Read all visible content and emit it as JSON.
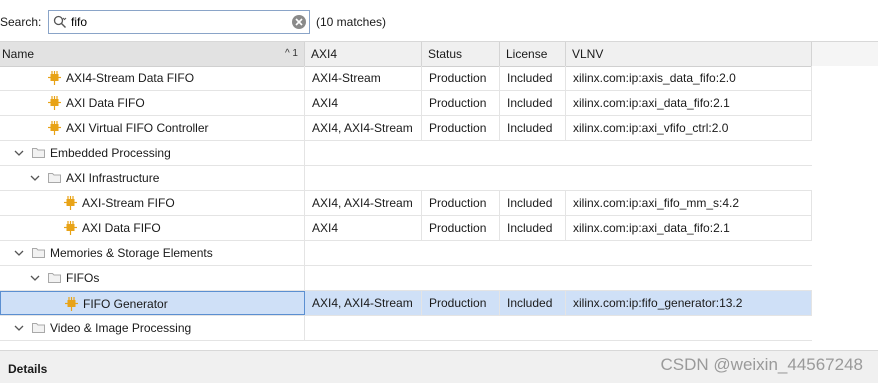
{
  "search": {
    "label": "Search:",
    "value": "fifo",
    "matches": "(10 matches)"
  },
  "columns": {
    "name": "Name",
    "sort": "^ 1",
    "axi4": "AXI4",
    "status": "Status",
    "license": "License",
    "vlnv": "VLNV"
  },
  "rows": [
    {
      "type": "ip",
      "level": 2,
      "name": "AXI4-Stream Data FIFO",
      "axi4": "AXI4-Stream",
      "status": "Production",
      "license": "Included",
      "vlnv": "xilinx.com:ip:axis_data_fifo:2.0"
    },
    {
      "type": "ip",
      "level": 2,
      "name": "AXI Data FIFO",
      "axi4": "AXI4",
      "status": "Production",
      "license": "Included",
      "vlnv": "xilinx.com:ip:axi_data_fifo:2.1"
    },
    {
      "type": "ip",
      "level": 2,
      "name": "AXI Virtual FIFO Controller",
      "axi4": "AXI4, AXI4-Stream",
      "status": "Production",
      "license": "Included",
      "vlnv": "xilinx.com:ip:axi_vfifo_ctrl:2.0"
    },
    {
      "type": "folder",
      "level": 0,
      "name": "Embedded Processing"
    },
    {
      "type": "folder",
      "level": 1,
      "name": "AXI Infrastructure"
    },
    {
      "type": "ip",
      "level": 3,
      "name": "AXI-Stream FIFO",
      "axi4": "AXI4, AXI4-Stream",
      "status": "Production",
      "license": "Included",
      "vlnv": "xilinx.com:ip:axi_fifo_mm_s:4.2"
    },
    {
      "type": "ip",
      "level": 3,
      "name": "AXI Data FIFO",
      "axi4": "AXI4",
      "status": "Production",
      "license": "Included",
      "vlnv": "xilinx.com:ip:axi_data_fifo:2.1"
    },
    {
      "type": "folder",
      "level": 0,
      "name": "Memories & Storage Elements"
    },
    {
      "type": "folder",
      "level": 1,
      "name": "FIFOs"
    },
    {
      "type": "ip",
      "level": 3,
      "name": "FIFO Generator",
      "axi4": "AXI4, AXI4-Stream",
      "status": "Production",
      "license": "Included",
      "vlnv": "xilinx.com:ip:fifo_generator:13.2",
      "selected": true
    },
    {
      "type": "folder",
      "level": 0,
      "name": "Video & Image Processing"
    }
  ],
  "footer": {
    "details": "Details",
    "watermark": "CSDN @weixin_44567248"
  },
  "icons": {
    "search": "search-icon",
    "clear": "clear-icon",
    "chevron": "chevron-down-icon",
    "folder": "folder-icon",
    "ip": "ip-core-icon"
  },
  "colors": {
    "selection": "#cfe0f7",
    "ip_icon": "#e8a317",
    "folder": "#a9a9a9"
  }
}
